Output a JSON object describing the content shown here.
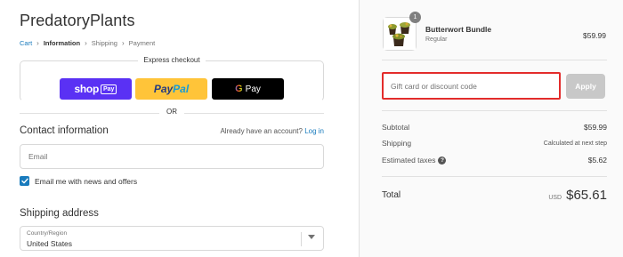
{
  "store": {
    "name": "PredatoryPlants"
  },
  "breadcrumb": {
    "cart": "Cart",
    "information": "Information",
    "shipping": "Shipping",
    "payment": "Payment",
    "separator": "›"
  },
  "express_checkout": {
    "title": "Express checkout",
    "shop_pay_word": "shop",
    "shop_pay_box": "Pay",
    "paypal_part1": "Pay",
    "paypal_part2": "Pal",
    "gpay_g": "G",
    "gpay_word": "Pay"
  },
  "divider": {
    "or": "OR"
  },
  "contact": {
    "title": "Contact information",
    "account_prompt": "Already have an account?",
    "login_link": "Log in",
    "email_placeholder": "Email",
    "email_value": "",
    "news_checkbox_label": "Email me with news and offers",
    "news_checked": true
  },
  "shipping_address": {
    "title": "Shipping address",
    "country_label": "Country/Region",
    "country_value": "United States"
  },
  "order": {
    "item": {
      "name": "Butterwort Bundle",
      "variant": "Regular",
      "price": "$59.99",
      "quantity": "1",
      "thumbnail": "butterwort-plants-image"
    }
  },
  "discount": {
    "placeholder": "Gift card or discount code",
    "value": "",
    "apply_label": "Apply",
    "highlight_color": "#e32c2b"
  },
  "summary": {
    "subtotal_label": "Subtotal",
    "subtotal_value": "$59.99",
    "shipping_label": "Shipping",
    "shipping_value": "Calculated at next step",
    "taxes_label": "Estimated taxes",
    "taxes_help_icon": "?",
    "taxes_value": "$5.62",
    "total_label": "Total",
    "currency": "USD",
    "total_value": "$65.61"
  },
  "colors": {
    "link": "#197bbd",
    "shop_pay": "#5a31f4",
    "paypal": "#ffc439",
    "gpay": "#000000",
    "apply_disabled": "#c8c8c8"
  }
}
